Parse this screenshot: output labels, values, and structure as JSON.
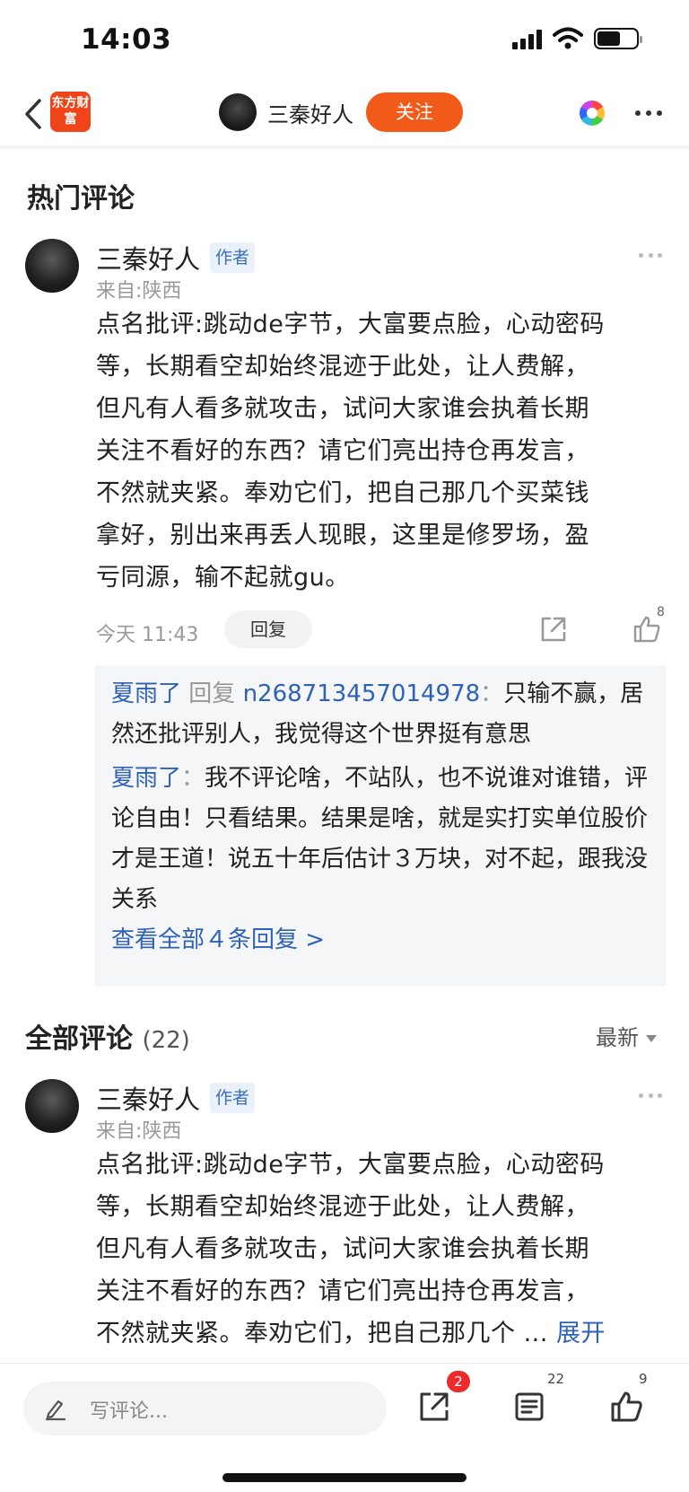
{
  "status_bar": {
    "time": "14:03"
  },
  "nav": {
    "brand_logo_text": "东方财富",
    "author_name": "三秦好人",
    "follow_label": "关注",
    "icons": [
      "back-arrow-icon",
      "color-wheel-icon",
      "more-dots-icon"
    ]
  },
  "hot_comments": {
    "title": "热门评论",
    "comment": {
      "author": "三秦好人",
      "badge": "作者",
      "location": "来自:陕西",
      "text": "点名批评:跳动de字节，大富要点脸，心动密码\n等，长期看空却始终混迹于此处，让人费解，\n但凡有人看多就攻击，试问大家谁会执着长期\n关注不看好的东西？请它们亮出持仓再发言，\n不然就夹紧。奉劝它们，把自己那几个买菜钱\n拿好，别出来再丢人现眼，这里是修罗场，盈\n亏同源，输不起就gu。",
      "time": "今天 11:43",
      "reply_label": "回复",
      "like_count": "8"
    },
    "replies": [
      {
        "user": "夏雨了",
        "reply_word": "回复",
        "target": "n268713457014978",
        "separator": "：",
        "text": "只输不赢，居然还批评别人，我觉得这个世界挺有意思"
      },
      {
        "user": "夏雨了",
        "separator": "：",
        "text": "我不评论啥，不站队，也不说谁对谁错，评论自由！只看结果。结果是啥，就是实打实单位股价才是王道！说五十年后估计３万块，对不起，跟我没关系"
      }
    ],
    "view_all_replies": "查看全部４条回复 >"
  },
  "all_comments": {
    "title": "全部评论",
    "count": "(22)",
    "sort_label": "最新",
    "comment": {
      "author": "三秦好人",
      "badge": "作者",
      "location": "来自:陕西",
      "text": "点名批评:跳动de字节，大富要点脸，心动密码\n等，长期看空却始终混迹于此处，让人费解，\n但凡有人看多就攻击，试问大家谁会执着长期\n关注不看好的东西？请它们亮出持仓再发言，\n不然就夹紧。奉劝它们，把自己那几个 ...",
      "expand_label": "展开"
    }
  },
  "bottom_bar": {
    "write_placeholder": "写评论...",
    "share_badge": "2",
    "comment_count": "22",
    "like_count": "9"
  },
  "colors": {
    "brand_orange": "#f25a1a",
    "link_blue": "#2f62b7",
    "badge_red": "#ee2b2b"
  }
}
